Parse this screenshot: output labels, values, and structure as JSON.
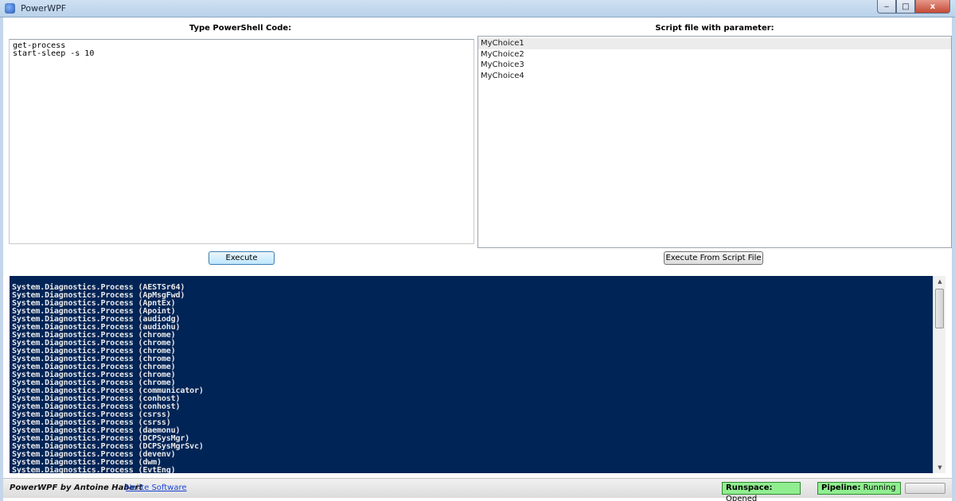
{
  "window": {
    "title": "PowerWPF",
    "controls": {
      "minimize": "‒",
      "maximize": "□",
      "close": "x"
    }
  },
  "left_panel": {
    "label": "Type PowerShell Code:",
    "code_lines": [
      "get-process",
      "start-sleep -s 10"
    ],
    "execute_button": "Execute"
  },
  "right_panel": {
    "label": "Script file with parameter:",
    "choices": [
      "MyChoice1",
      "MyChoice2",
      "MyChoice3",
      "MyChoice4"
    ],
    "selected_index": 0,
    "execute_script_button": "Execute From Script File"
  },
  "console": {
    "background": "#012456",
    "lines": [
      "System.Diagnostics.Process (AESTSr64)",
      "System.Diagnostics.Process (ApMsgFwd)",
      "System.Diagnostics.Process (ApntEx)",
      "System.Diagnostics.Process (Apoint)",
      "System.Diagnostics.Process (audiodg)",
      "System.Diagnostics.Process (audiohu)",
      "System.Diagnostics.Process (chrome)",
      "System.Diagnostics.Process (chrome)",
      "System.Diagnostics.Process (chrome)",
      "System.Diagnostics.Process (chrome)",
      "System.Diagnostics.Process (chrome)",
      "System.Diagnostics.Process (chrome)",
      "System.Diagnostics.Process (chrome)",
      "System.Diagnostics.Process (communicator)",
      "System.Diagnostics.Process (conhost)",
      "System.Diagnostics.Process (conhost)",
      "System.Diagnostics.Process (csrss)",
      "System.Diagnostics.Process (csrss)",
      "System.Diagnostics.Process (daemonu)",
      "System.Diagnostics.Process (DCPSysMgr)",
      "System.Diagnostics.Process (DCPSysMgrSvc)",
      "System.Diagnostics.Process (devenv)",
      "System.Diagnostics.Process (dwm)",
      "System.Diagnostics.Process (EvtEng)"
    ]
  },
  "statusbar": {
    "credit": "PowerWPF by Antoine Habert",
    "link": "Nelite Software",
    "runspace_label": "Runspace:",
    "runspace_value": "Opened",
    "pipeline_label": "Pipeline:",
    "pipeline_value": "Running",
    "status_color": "#90ee90"
  }
}
